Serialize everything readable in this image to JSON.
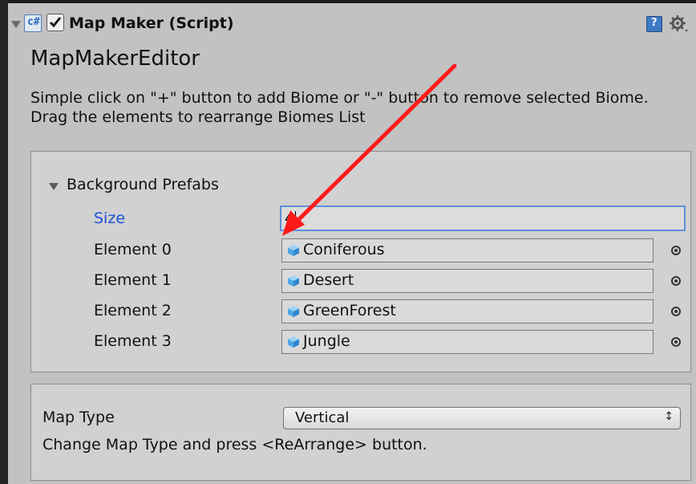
{
  "component": {
    "title": "Map Maker (Script)",
    "script_icon_glyph": "c#",
    "enabled": true,
    "help_icon": "help-icon",
    "settings_icon": "gear-icon"
  },
  "editor": {
    "name": "MapMakerEditor",
    "description": "Simple click on \"+\" button to add Biome or \"-\" button to remove selected Biome. Drag the elements to rearrange Biomes List"
  },
  "background_prefabs": {
    "label": "Background Prefabs",
    "size_label": "Size",
    "size_value": "4",
    "elements": [
      {
        "label": "Element 0",
        "value": "Coniferous"
      },
      {
        "label": "Element 1",
        "value": "Desert"
      },
      {
        "label": "Element 2",
        "value": "GreenForest"
      },
      {
        "label": "Element 3",
        "value": "Jungle"
      }
    ]
  },
  "map_type": {
    "label": "Map Type",
    "selected": "Vertical",
    "help": "Change Map Type and press <ReArrange> button."
  },
  "colors": {
    "panel_bg": "#c2c2c2",
    "box_bg": "#d1d1d1",
    "size_label": "#1d4fd8",
    "focus_border": "#5d8fd8",
    "annotation_arrow": "#ff1a1a"
  }
}
